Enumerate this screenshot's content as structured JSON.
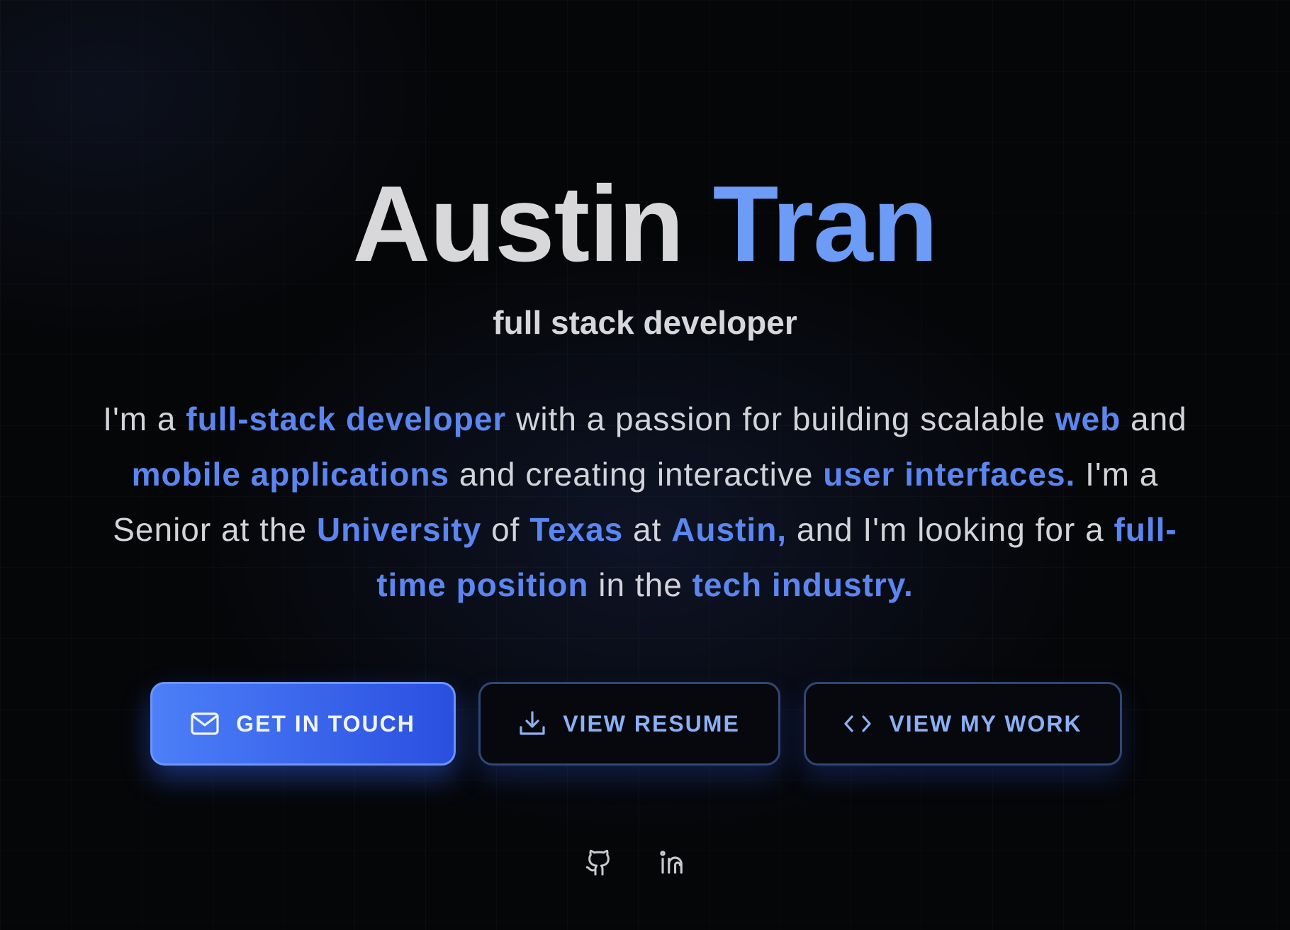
{
  "hero": {
    "name_first": "Austin",
    "name_last": "Tran",
    "subtitle": "full stack developer",
    "bio": [
      {
        "text": "I'm a ",
        "highlight": false
      },
      {
        "text": "full-stack developer",
        "highlight": true
      },
      {
        "text": " with a passion for building scalable ",
        "highlight": false
      },
      {
        "text": "web",
        "highlight": true
      },
      {
        "text": " and ",
        "highlight": false
      },
      {
        "text": "mobile applications",
        "highlight": true
      },
      {
        "text": " and creating interactive ",
        "highlight": false
      },
      {
        "text": "user interfaces.",
        "highlight": true
      },
      {
        "text": " I'm a Senior at the ",
        "highlight": false
      },
      {
        "text": "University",
        "highlight": true
      },
      {
        "text": " of ",
        "highlight": false
      },
      {
        "text": "Texas",
        "highlight": true
      },
      {
        "text": " at ",
        "highlight": false
      },
      {
        "text": "Austin,",
        "highlight": true
      },
      {
        "text": " and I'm looking for a ",
        "highlight": false
      },
      {
        "text": "full-time position",
        "highlight": true
      },
      {
        "text": " in the ",
        "highlight": false
      },
      {
        "text": "tech industry.",
        "highlight": true
      }
    ]
  },
  "buttons": {
    "contact": {
      "label": "GET IN TOUCH",
      "icon": "mail-icon"
    },
    "resume": {
      "label": "VIEW RESUME",
      "icon": "download-icon"
    },
    "work": {
      "label": "VIEW MY WORK",
      "icon": "code-icon"
    }
  },
  "socials": {
    "github": {
      "icon": "github-icon"
    },
    "linkedin": {
      "icon": "linkedin-icon"
    }
  },
  "colors": {
    "accent": "#5b86f0",
    "name_accent": "#6d9cf6",
    "primary_button": "#3a66ee",
    "outline_border": "#2f4776",
    "background": "#050608",
    "text": "#d2d4da"
  }
}
